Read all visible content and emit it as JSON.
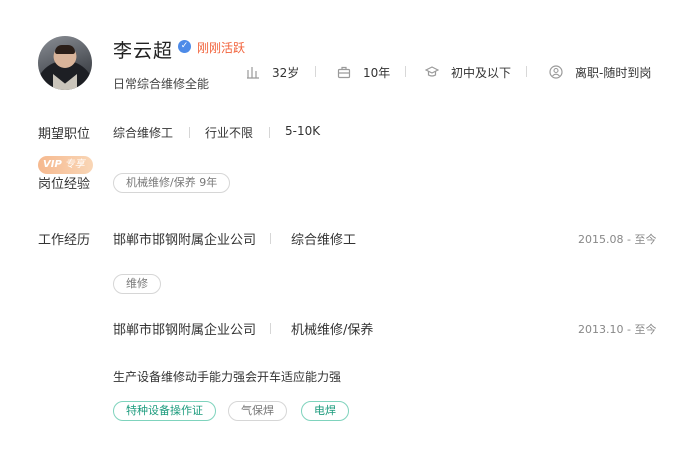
{
  "profile": {
    "name": "李云超",
    "active_status": "刚刚活跃",
    "tagline": "日常综合维修全能",
    "age": "32岁",
    "experience": "10年",
    "education": "初中及以下",
    "job_status": "离职-随时到岗"
  },
  "expected_position": {
    "label": "期望职位",
    "role": "综合维修工",
    "industry": "行业不限",
    "salary": "5-10K"
  },
  "vip": {
    "badge_text": "专享"
  },
  "position_experience": {
    "label": "岗位经验",
    "tags": [
      "机械维修/保养 9年"
    ]
  },
  "work_history": {
    "label": "工作经历",
    "entries": [
      {
        "company": "邯郸市邯钢附属企业公司",
        "role": "综合维修工",
        "period": "2015.08 - 至今",
        "tags": [
          "维修"
        ]
      },
      {
        "company": "邯郸市邯钢附属企业公司",
        "role": "机械维修/保养",
        "period": "2013.10 - 至今",
        "description": "生产设备维修动手能力强会开车适应能力强",
        "tags": [
          "特种设备操作证",
          "气保焊",
          "电焊"
        ]
      }
    ]
  },
  "colors": {
    "active": "#f2623b",
    "verify": "#4d8be8",
    "skill_green": "#1c9b7d",
    "vip_gradient": "#f6b98f"
  },
  "icons": {
    "age": "height-bars-icon",
    "experience": "briefcase-icon",
    "education": "graduation-cap-icon",
    "job_status": "person-icon",
    "verify": "verified-icon"
  }
}
